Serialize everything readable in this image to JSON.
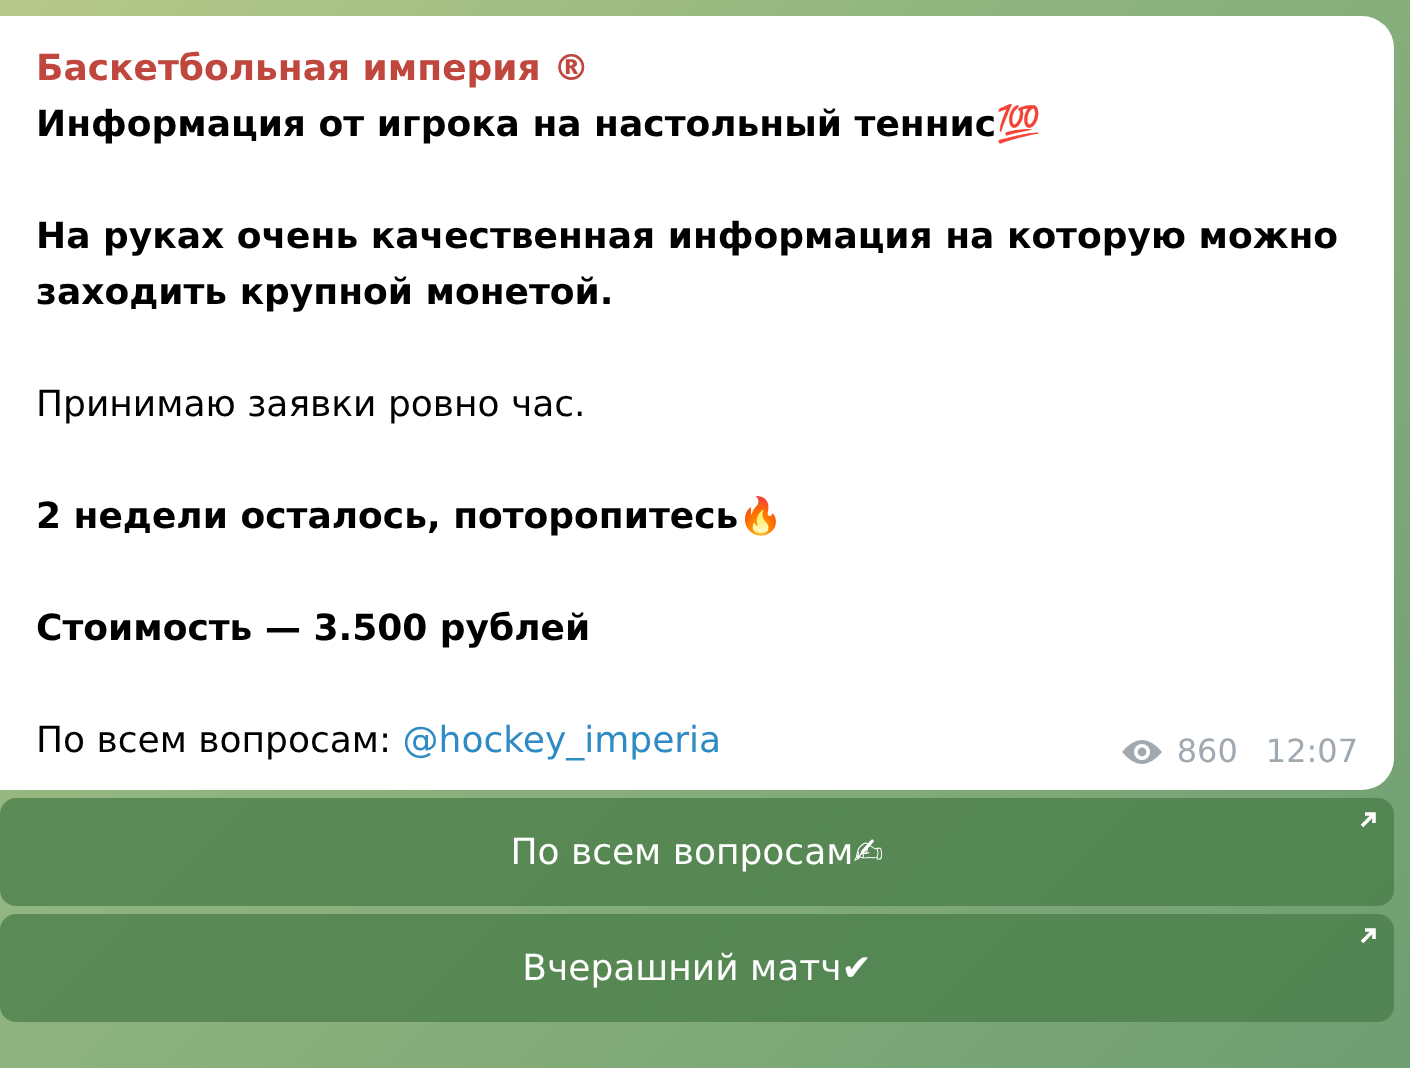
{
  "message": {
    "channel": "Баскетбольная империя ®",
    "paragraphs": [
      {
        "kind": "bold",
        "text": "Информация от игрока на настольный теннис💯"
      },
      {
        "kind": "bold",
        "text": "На руках очень качественная информация на которую можно заходить крупной монетой."
      },
      {
        "kind": "plain",
        "text": "Принимаю заявки ровно час."
      },
      {
        "kind": "bold",
        "text": "2 недели осталось, поторопитесь🔥"
      },
      {
        "kind": "bold",
        "text": "Стоимость — 3.500 рублей"
      },
      {
        "kind": "link",
        "text": "По всем вопросам:",
        "link": "@hockey_imperia"
      }
    ],
    "views": "860",
    "time": "12:07"
  },
  "buttons": [
    {
      "label": "По всем вопросам✍"
    },
    {
      "label": "Вчерашний матч✔"
    }
  ]
}
